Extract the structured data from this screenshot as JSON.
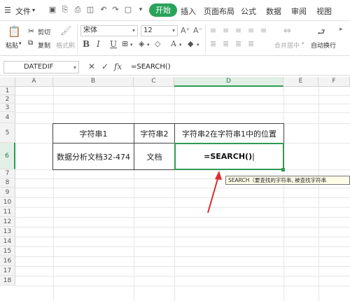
{
  "menu": {
    "file": "文件",
    "start": "开始",
    "tabs": [
      "插入",
      "页面布局",
      "公式",
      "数据",
      "审阅",
      "视图"
    ]
  },
  "ribbon": {
    "paste": "粘贴",
    "cut": "剪切",
    "copy": "复制",
    "format_painter": "格式刷",
    "font_name": "宋体",
    "font_size": "12",
    "merge_center": "合并居中",
    "auto_wrap": "自动换行"
  },
  "formula_bar": {
    "name_box": "DATEDIF",
    "formula": "=SEARCH()"
  },
  "columns": [
    "A",
    "B",
    "C",
    "D",
    "E",
    "F"
  ],
  "rows": [
    "1",
    "2",
    "3",
    "4",
    "5",
    "6",
    "7",
    "8",
    "9",
    "10",
    "11",
    "12",
    "13",
    "14",
    "15",
    "16",
    "17",
    "18"
  ],
  "table": {
    "header_b": "字符串1",
    "header_c": "字符串2",
    "header_d": "字符串2在字符串1中的位置",
    "value_b": "数据分析文档32-474",
    "value_c": "文档",
    "value_d": "=SEARCH()"
  },
  "tooltip": "SEARCH（要查找的字符串, 被查找字符串",
  "colors": {
    "accent": "#29a35a",
    "selection": "#2e9b52",
    "arrow": "#e02b2b"
  }
}
